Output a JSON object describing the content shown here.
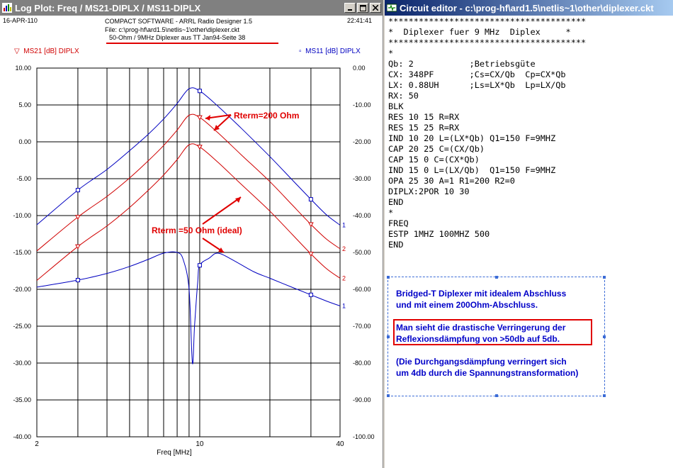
{
  "plot_window": {
    "title": "Log Plot: Freq / MS21-DIPLX / MS11-DIPLX",
    "date": "16-APR-110",
    "time": "22:41:41",
    "software": "COMPACT SOFTWARE - ARRL Radio Designer 1.5",
    "file_label": "File: c:\\prog-hf\\ard1.5\\netlis~1\\other\\diplexer.ckt",
    "subtitle": "50-Ohm / 9MHz Diplexer aus  TT Jan94-Seite 38",
    "legend_left": "MS21 [dB] DIPLX",
    "legend_right": "MS11 [dB] DIPLX",
    "annotation_200": "Rterm=200 Ohm",
    "annotation_50": "Rterm =50 Ohm (ideal)",
    "colors": {
      "ms21": "#d00000",
      "ms11": "#0000c0",
      "annotation": "#e00000",
      "grid": "#000000"
    }
  },
  "chart_data": {
    "type": "line",
    "xlabel": "Freq [MHz]",
    "xscale": "log",
    "xlim": [
      2,
      40
    ],
    "x_ticks": [
      2,
      10,
      40
    ],
    "y_left_label": "MS21 [dB] DIPLX",
    "y_left_lim": [
      -40,
      10
    ],
    "y_left_ticks": [
      "10.00",
      "5.00",
      "0.00",
      "-5.00",
      "-10.00",
      "-15.00",
      "-20.00",
      "-25.00",
      "-30.00",
      "-35.00",
      "-40.00"
    ],
    "y_right_label": "MS11 [dB] DIPLX",
    "y_right_lim": [
      -100,
      0
    ],
    "y_right_ticks": [
      "0.00",
      "-10.00",
      "-20.00",
      "-30.00",
      "-40.00",
      "-50.00",
      "-60.00",
      "-70.00",
      "-80.00",
      "-90.00",
      "-100.00"
    ],
    "grid": true,
    "series": [
      {
        "name": "MS21 [dB] DIPLX",
        "axis": "left",
        "x": [
          2,
          3,
          4,
          5,
          6,
          7,
          8,
          9,
          10,
          12,
          15,
          20,
          25,
          30,
          35,
          40
        ],
        "y": [
          -18.8,
          -14.2,
          -11.4,
          -8.9,
          -6.6,
          -4.5,
          -2.4,
          -0.4,
          -0.7,
          -2.8,
          -5.7,
          -9.4,
          -12.6,
          -15.2,
          -17.2,
          -18.5
        ]
      },
      {
        "name": "MS21 [dB] DIPLX",
        "axis": "left",
        "x": [
          2,
          3,
          4,
          5,
          6,
          7,
          8,
          9,
          10,
          12,
          15,
          20,
          25,
          30,
          35,
          40
        ],
        "y": [
          -14.8,
          -10.2,
          -7.4,
          -4.9,
          -2.6,
          -0.5,
          1.6,
          3.6,
          3.3,
          1.2,
          -1.7,
          -5.4,
          -8.6,
          -11.2,
          -13.2,
          -14.5
        ]
      },
      {
        "name": "MS11 [dB] DIPLX",
        "axis": "right",
        "x": [
          2,
          3,
          4,
          5,
          6,
          7,
          8,
          9,
          10,
          12,
          15,
          20,
          25,
          30,
          35,
          40
        ],
        "y": [
          -42.5,
          -33.1,
          -27.5,
          -22.4,
          -18.0,
          -13.8,
          -9.6,
          -5.6,
          -6.2,
          -10.4,
          -16.2,
          -24.0,
          -30.4,
          -35.6,
          -39.8,
          -42.6
        ]
      },
      {
        "name": "MS11 [dB] DIPLX",
        "axis": "right",
        "x": [
          2,
          3,
          4,
          5,
          6,
          7,
          8,
          8.5,
          9,
          9.3,
          9.5,
          9.8,
          10,
          11,
          12,
          14,
          17,
          20,
          25,
          30,
          35,
          40
        ],
        "y": [
          -59.4,
          -57.5,
          -55.7,
          -53.8,
          -51.9,
          -50.2,
          -50.0,
          -52.0,
          -60.0,
          -80.0,
          -70.0,
          -58.0,
          -53.5,
          -51.5,
          -50.2,
          -52.2,
          -55.2,
          -57.0,
          -59.5,
          -61.5,
          -63.2,
          -64.5
        ]
      }
    ]
  },
  "editor_window": {
    "title": "Circuit editor - c:\\prog-hf\\ard1.5\\netlis~1\\other\\diplexer.ckt",
    "lines": [
      "***************************************",
      "*  Diplexer fuer 9 MHz  Diplex     *",
      "***************************************",
      "*",
      "Qb: 2           ;Betriebsgüte",
      "CX: 348PF       ;Cs=CX/Qb  Cp=CX*Qb",
      "LX: 0.88UH      ;Ls=LX*Qb  Lp=LX/Qb",
      "RX: 50",
      "BLK",
      "RES 10 15 R=RX",
      "RES 15 25 R=RX",
      "IND 10 20 L=(LX*Qb) Q1=150 F=9MHZ",
      "CAP 20 25 C=(CX/Qb)",
      "CAP 15 0 C=(CX*Qb)",
      "IND 15 0 L=(LX/Qb)  Q1=150 F=9MHZ",
      "OPA 25 30 A=1 R1=200 R2=0",
      "DIPLX:2POR 10 30",
      "END",
      "*",
      "FREQ",
      "ESTP 1MHZ 100MHZ 500",
      "END"
    ],
    "notes": {
      "line1": "Bridged-T Diplexer mit idealem Abschluss",
      "line2": "und mit einem 200Ohm-Abschluss.",
      "line3": "Man sieht die drastische Verringerung der",
      "line4": "Reflexionsdämpfung von >50db auf  5db.",
      "line5": "(Die Durchgangsdämpfung verringert sich",
      "line6": "um 4db durch die Spannungstransformation)"
    }
  }
}
